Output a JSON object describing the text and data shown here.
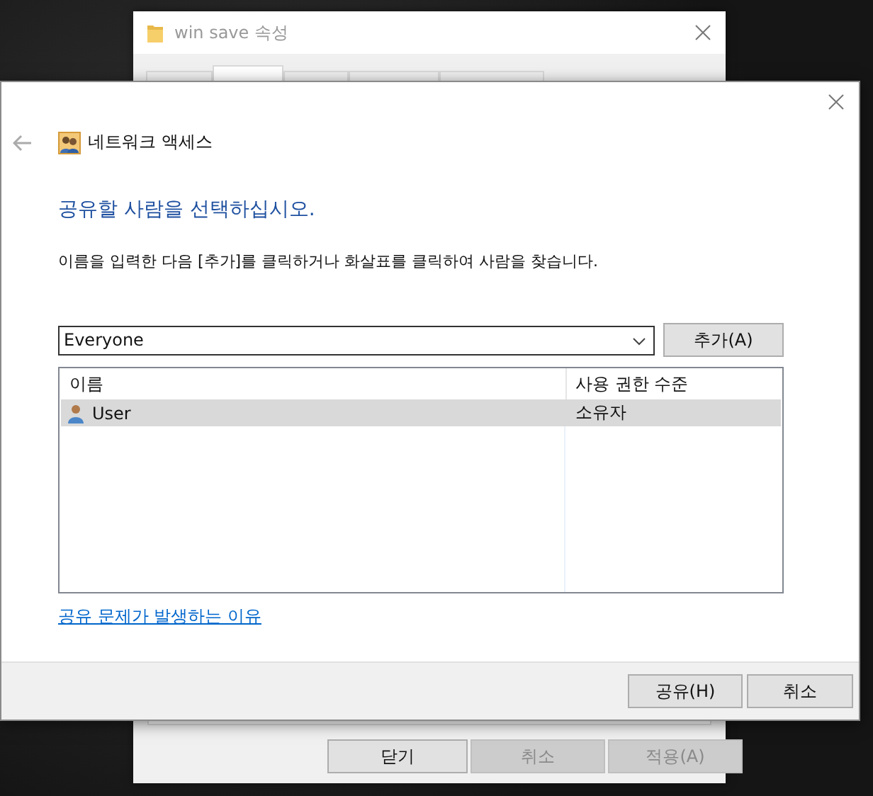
{
  "back_window": {
    "title": "win save 속성",
    "tabs": [
      {
        "selected": false
      },
      {
        "selected": true
      },
      {
        "selected": false
      },
      {
        "selected": false
      },
      {
        "selected": false
      }
    ],
    "buttons": [
      {
        "label": "닫기",
        "disabled": false
      },
      {
        "label": "취소",
        "disabled": true
      },
      {
        "label": "적용(A)",
        "disabled": true
      }
    ]
  },
  "dialog": {
    "nav_title": "네트워크 액세스",
    "heading": "공유할 사람을 선택하십시오.",
    "instruction": "이름을 입력한 다음 [추가]를 클릭하거나 화살표를 클릭하여 사람을 찾습니다.",
    "name_field": {
      "value": "Everyone"
    },
    "add_button": "추가(A)",
    "table": {
      "columns": [
        "이름",
        "사용 권한 수준"
      ],
      "rows": [
        {
          "name": "User",
          "permission": "소유자",
          "selected": true
        }
      ]
    },
    "help_link": "공유 문제가 발생하는 이유",
    "buttons": [
      "공유(H)",
      "취소"
    ]
  }
}
